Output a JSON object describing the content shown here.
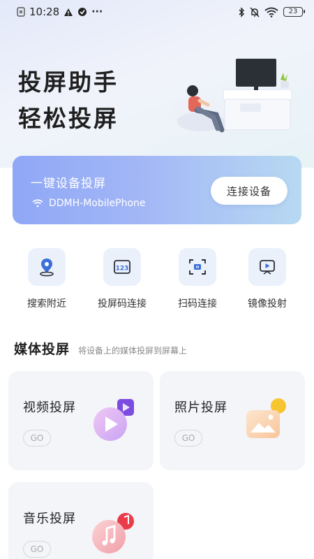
{
  "status_bar": {
    "time": "10:28",
    "battery": "23",
    "more": "···"
  },
  "hero": {
    "title_line1": "投屏助手",
    "title_line2": "轻松投屏"
  },
  "banner": {
    "title": "一键设备投屏",
    "device_name": "DDMH-MobilePhone",
    "connect_label": "连接设备"
  },
  "quick_actions": [
    {
      "label": "搜索附近",
      "icon": "location-pin-icon"
    },
    {
      "label": "投屏码连接",
      "icon": "code-123-icon"
    },
    {
      "label": "扫码连接",
      "icon": "scan-icon"
    },
    {
      "label": "镜像投射",
      "icon": "mirror-cast-icon"
    }
  ],
  "media_section": {
    "title": "媒体投屏",
    "subtitle": "将设备上的媒体投屏到屏幕上",
    "cards": [
      {
        "title": "视频投屏",
        "go": "GO",
        "icon": "play-icon"
      },
      {
        "title": "照片投屏",
        "go": "GO",
        "icon": "image-icon"
      },
      {
        "title": "音乐投屏",
        "go": "GO",
        "icon": "music-note-icon"
      }
    ]
  },
  "colors": {
    "banner_start": "#8fa7f6",
    "banner_end": "#b7d9f2",
    "accent_blue": "#3b6fd8"
  }
}
